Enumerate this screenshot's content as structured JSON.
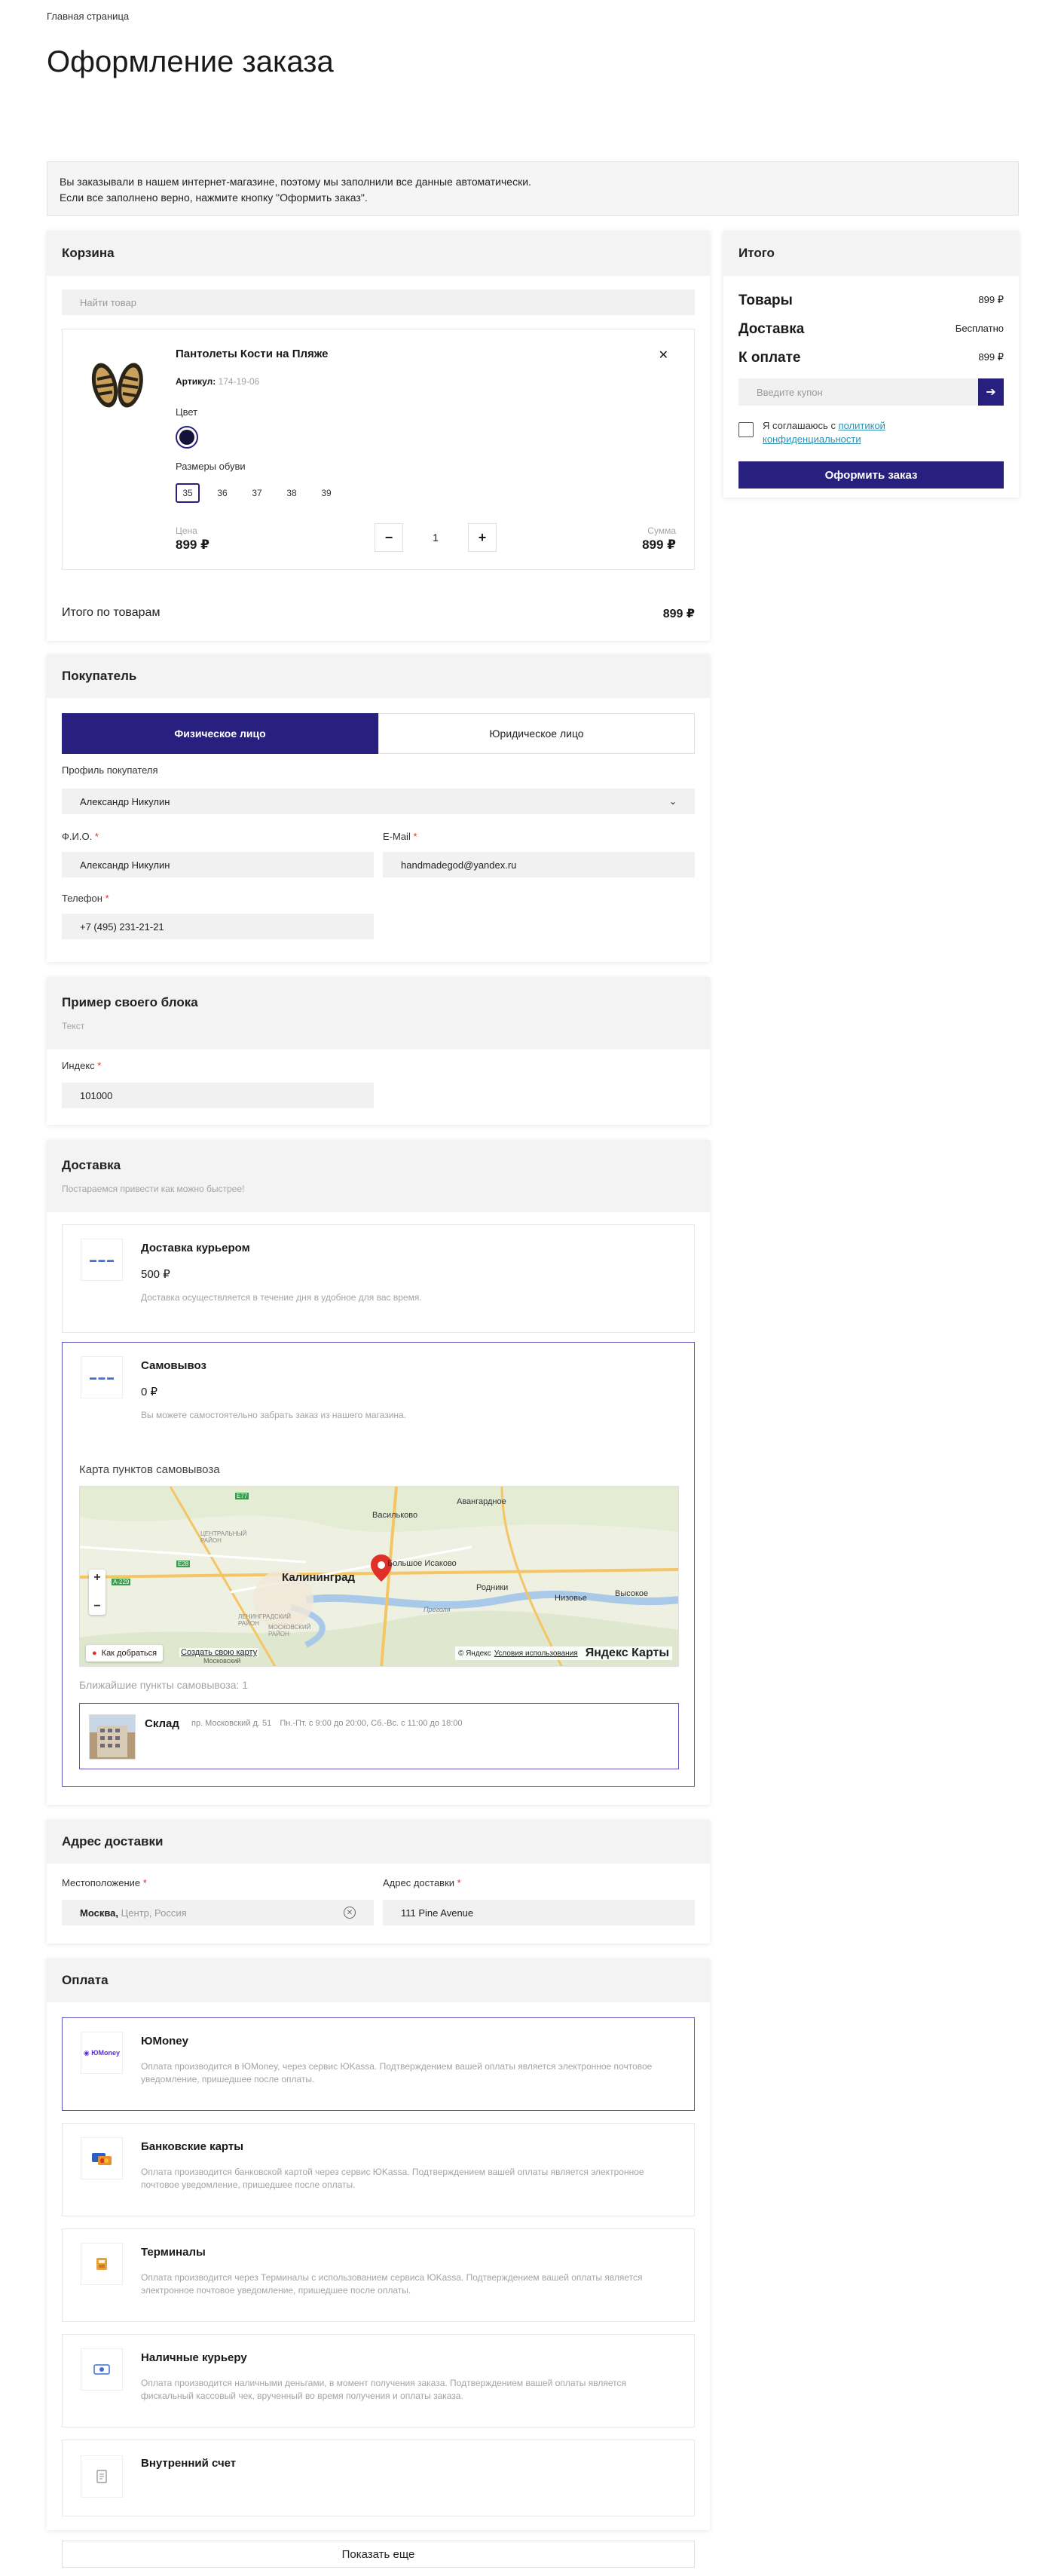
{
  "breadcrumb": "Главная страница",
  "page_title": "Оформление заказа",
  "notice": {
    "line1": "Вы заказывали в нашем интернет-магазине, поэтому мы заполнили все данные автоматически.",
    "line2": "Если все заполнено верно, нажмите кнопку \"Оформить заказ\"."
  },
  "cart": {
    "title": "Корзина",
    "search_placeholder": "Найти товар",
    "product": {
      "name": "Пантолеты Кости на Пляже",
      "article_label": "Артикул:",
      "article_value": "174-19-06",
      "color_label": "Цвет",
      "sizes_label": "Размеры обуви",
      "sizes": [
        "35",
        "36",
        "37",
        "38",
        "39"
      ],
      "selected_size": "35",
      "price_label": "Цена",
      "price": "899 ₽",
      "quantity": "1",
      "sum_label": "Сумма",
      "sum": "899 ₽"
    },
    "total_label": "Итого по товарам",
    "total": "899 ₽"
  },
  "buyer": {
    "title": "Покупатель",
    "tab_individual": "Физическое лицо",
    "tab_legal": "Юридическое лицо",
    "profile_label": "Профиль покупателя",
    "profile_value": "Александр Никулин",
    "fio_label": "Ф.И.О.",
    "fio_value": "Александр Никулин",
    "email_label": "E-Mail",
    "email_value": "handmadegod@yandex.ru",
    "phone_label": "Телефон",
    "phone_value": "+7 (495) 231-21-21",
    "required_mark": "*"
  },
  "custom_block": {
    "title": "Пример своего блока",
    "subtitle": "Текст",
    "index_label": "Индекс",
    "index_value": "101000"
  },
  "delivery": {
    "title": "Доставка",
    "subtitle": "Постараемся привести как можно быстрее!",
    "options": [
      {
        "title": "Доставка курьером",
        "price": "500 ₽",
        "desc": "Доставка осуществляется в течение дня в удобное для вас время."
      },
      {
        "title": "Самовывоз",
        "price": "0 ₽",
        "desc": "Вы можете самостоятельно забрать заказ из нашего магазина."
      }
    ],
    "map_title": "Карта пунктов самовывоза",
    "map_labels": {
      "city": "Калининград",
      "avangardnoe": "Авангардное",
      "vasilkovo": "Васильково",
      "bolshoe_isakovo": "Большое Исаково",
      "rodniki": "Родники",
      "nizovye": "Низовье",
      "vysokoe": "Высокое",
      "centralny": "ЦЕНТРАЛЬНЫЙ РАЙОН",
      "moskovsky": "МОСКОВСКИЙ РАЙОН",
      "leninsky": "ЛЕНИНГРАДСКИЙ РАЙОН",
      "r_e77": "E77",
      "r_a229": "A-229",
      "r_e28": "E28",
      "r_pregol": "Преголя",
      "r_moskovsky_pr": "Московский"
    },
    "map_route_btn": "Как добраться",
    "map_create_link": "Создать свою карту",
    "map_copyright": "© Яндекс",
    "map_terms": "Условия использования",
    "map_brand": "Яндекс Карты",
    "nearest_label": "Ближайшие пункты самовывоза: 1",
    "point": {
      "name": "Склад",
      "address": "пр. Московский д. 51",
      "hours": "Пн.-Пт. с 9:00 до 20:00, Сб.-Вс. с 11:00 до 18:00"
    }
  },
  "address": {
    "title": "Адрес доставки",
    "location_label": "Местоположение",
    "location_city": "Москва,",
    "location_rest": "Центр, Россия",
    "address_label": "Адрес доставки",
    "address_value": "111 Pine Avenue"
  },
  "payment": {
    "title": "Оплата",
    "options": [
      {
        "title": "ЮMoney",
        "desc": "Оплата производится в ЮMoney, через сервис ЮKassa. Подтверждением вашей оплаты является электронное почтовое уведомление, пришедшее после оплаты."
      },
      {
        "title": "Банковские карты",
        "desc": "Оплата производится банковской картой через сервис ЮKassa. Подтверждением вашей оплаты является электронное почтовое уведомление, пришедшее после оплаты."
      },
      {
        "title": "Терминалы",
        "desc": "Оплата производится через Терминалы с использованием сервиса ЮKassa. Подтверждением вашей оплаты является электронное почтовое уведомление, пришедшее после оплаты."
      },
      {
        "title": "Наличные курьеру",
        "desc": "Оплата производится наличными деньгами, в момент получения заказа. Подтверждением вашей оплаты является фискальный кассовый чек, врученный во время получения и оплаты заказа."
      },
      {
        "title": "Внутренний счет",
        "desc": ""
      }
    ],
    "show_more": "Показать еще"
  },
  "summary": {
    "title": "Итого",
    "goods_label": "Товары",
    "goods_value": "899 ₽",
    "delivery_label": "Доставка",
    "delivery_value": "Бесплатно",
    "pay_label": "К оплате",
    "pay_value": "899 ₽",
    "coupon_placeholder": "Введите купон",
    "agree_text": "Я соглашаюсь с ",
    "agree_link": "политикой конфиденциальности",
    "submit": "Оформить заказ"
  },
  "colors": {
    "accent": "#27207e",
    "selected_border": "#5a56b8",
    "required": "#d9342b",
    "link": "#2f8fb3"
  }
}
